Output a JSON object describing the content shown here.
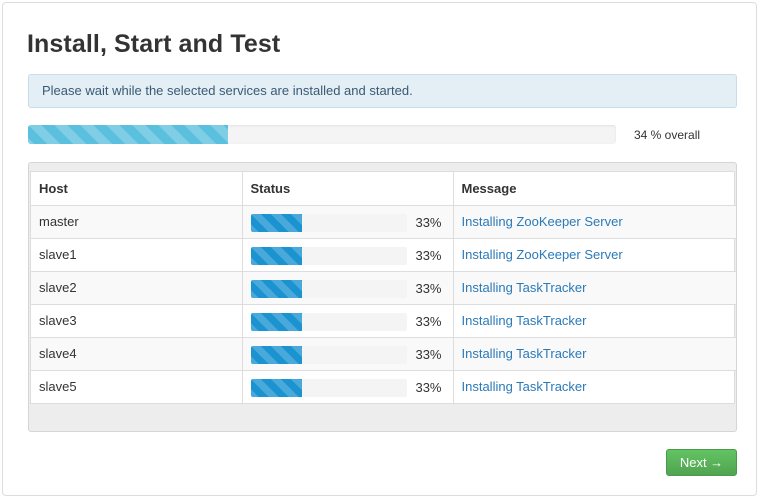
{
  "page": {
    "title": "Install, Start and Test",
    "alert_text": "Please wait while the selected services are installed and started."
  },
  "overall": {
    "progress_percent": 34,
    "label": "34 % overall"
  },
  "table": {
    "headers": {
      "host": "Host",
      "status": "Status",
      "message": "Message"
    },
    "rows": [
      {
        "host": "master",
        "progress_percent": 33,
        "percent_label": "33%",
        "message": "Installing ZooKeeper Server"
      },
      {
        "host": "slave1",
        "progress_percent": 33,
        "percent_label": "33%",
        "message": "Installing ZooKeeper Server"
      },
      {
        "host": "slave2",
        "progress_percent": 33,
        "percent_label": "33%",
        "message": "Installing TaskTracker"
      },
      {
        "host": "slave3",
        "progress_percent": 33,
        "percent_label": "33%",
        "message": "Installing TaskTracker"
      },
      {
        "host": "slave4",
        "progress_percent": 33,
        "percent_label": "33%",
        "message": "Installing TaskTracker"
      },
      {
        "host": "slave5",
        "progress_percent": 33,
        "percent_label": "33%",
        "message": "Installing TaskTracker"
      }
    ]
  },
  "footer": {
    "next_label": "Next →"
  },
  "colors": {
    "overall_bar": "#5bc0de",
    "host_bar": "#1b93d1",
    "message_link": "#2a7ab8",
    "next_button": "#5bb75b"
  }
}
